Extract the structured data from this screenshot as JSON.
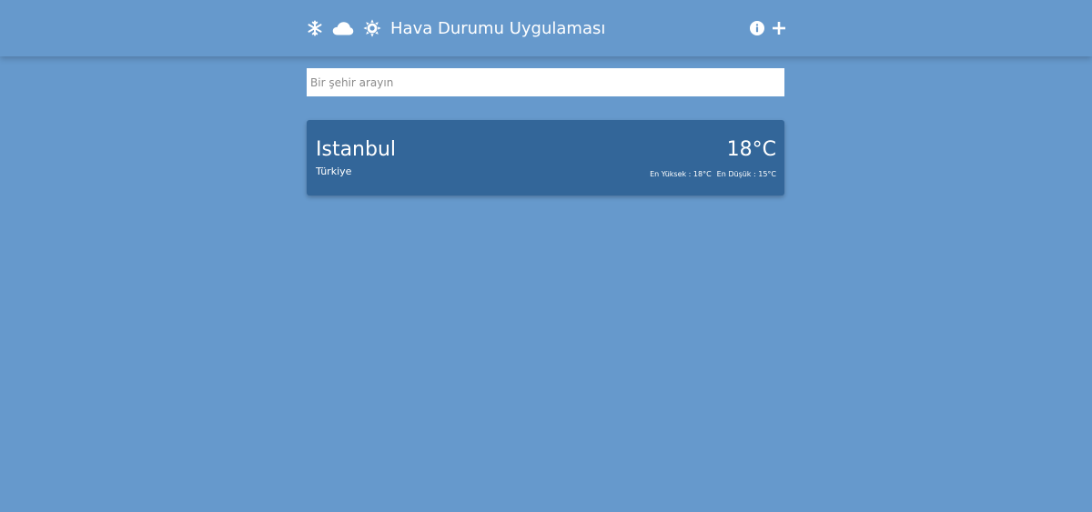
{
  "header": {
    "title": "Hava Durumu Uygulaması",
    "icons": [
      "snowflake-icon",
      "cloud-icon",
      "sun-icon"
    ],
    "actions": [
      "info-icon",
      "plus-icon"
    ]
  },
  "search": {
    "placeholder": "Bir şehir arayın",
    "value": ""
  },
  "cards": [
    {
      "city": "Istanbul",
      "country": "Türkiye",
      "temperature": "18°C",
      "high": "En Yüksek : 18°C",
      "low": "En Düşük : 15°C"
    }
  ],
  "colors": {
    "background": "#6699cc",
    "card": "#336699",
    "text": "#ffffff"
  }
}
